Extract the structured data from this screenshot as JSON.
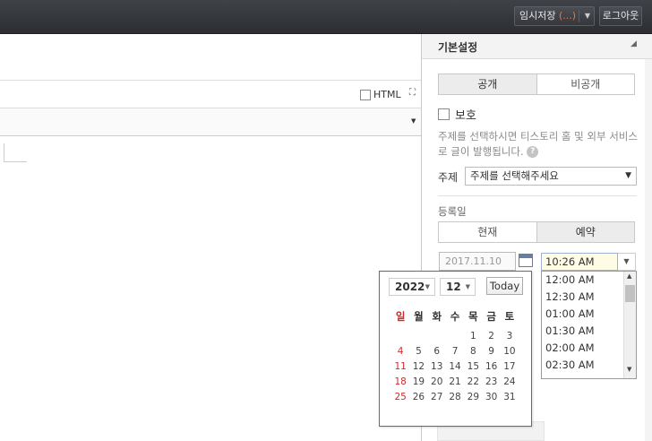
{
  "topbar": {
    "save_label": "임시저장",
    "save_count": "(...)",
    "logout_label": "로그아웃"
  },
  "editor": {
    "html_label": "HTML"
  },
  "sidebar": {
    "title": "기본설정",
    "visibility": {
      "options": [
        "공개",
        "비공개"
      ],
      "selected": "공개"
    },
    "protect_label": "보호",
    "description": "주제를 선택하시면 티스토리 홈 및 외부 서비스로 글이 발행됩니다.",
    "subject_label": "주제",
    "subject_select": "주제를 선택해주세요",
    "register_label": "등록일",
    "schedule": {
      "options": [
        "현재",
        "예약"
      ],
      "selected": "예약"
    },
    "date_value": "2017.11.10",
    "time_value": "10:26 AM",
    "time_options": [
      "12:00 AM",
      "12:30 AM",
      "01:00 AM",
      "01:30 AM",
      "02:00 AM",
      "02:30 AM"
    ]
  },
  "calendar": {
    "year": "2022",
    "month": "12",
    "today_label": "Today",
    "weekdays": [
      "일",
      "월",
      "화",
      "수",
      "목",
      "금",
      "토"
    ],
    "weeks": [
      [
        "",
        "",
        "",
        "",
        "1",
        "2",
        "3"
      ],
      [
        "4",
        "5",
        "6",
        "7",
        "8",
        "9",
        "10"
      ],
      [
        "11",
        "12",
        "13",
        "14",
        "15",
        "16",
        "17"
      ],
      [
        "18",
        "19",
        "20",
        "21",
        "22",
        "23",
        "24"
      ],
      [
        "25",
        "26",
        "27",
        "28",
        "29",
        "30",
        "31"
      ]
    ]
  },
  "colors": {
    "topbar": "#35373b",
    "accent_count": "#ff6d3a",
    "sunday": "#d12a2a"
  }
}
